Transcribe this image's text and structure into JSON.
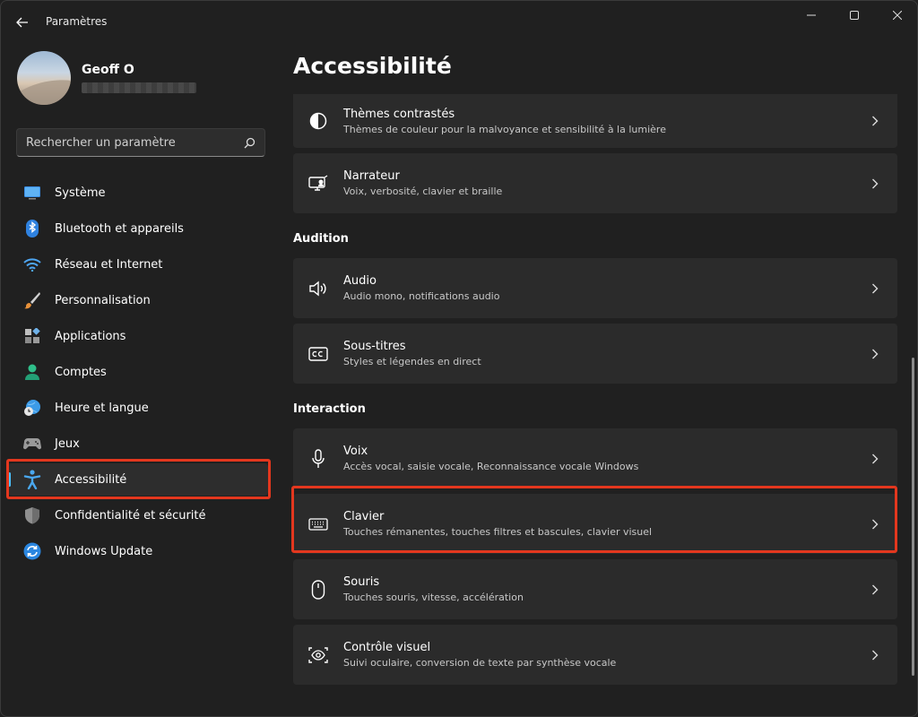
{
  "window": {
    "title": "Paramètres"
  },
  "profile": {
    "name": "Geoff O"
  },
  "search": {
    "placeholder": "Rechercher un paramètre"
  },
  "nav": {
    "items": [
      {
        "label": "Système",
        "icon": "monitor-icon"
      },
      {
        "label": "Bluetooth et appareils",
        "icon": "bluetooth-icon"
      },
      {
        "label": "Réseau et Internet",
        "icon": "wifi-icon"
      },
      {
        "label": "Personnalisation",
        "icon": "brush-icon"
      },
      {
        "label": "Applications",
        "icon": "apps-icon"
      },
      {
        "label": "Comptes",
        "icon": "person-icon"
      },
      {
        "label": "Heure et langue",
        "icon": "globe-clock-icon"
      },
      {
        "label": "Jeux",
        "icon": "gamepad-icon"
      },
      {
        "label": "Accessibilité",
        "icon": "accessibility-icon",
        "active": true
      },
      {
        "label": "Confidentialité et sécurité",
        "icon": "shield-icon"
      },
      {
        "label": "Windows Update",
        "icon": "update-icon"
      }
    ]
  },
  "main": {
    "title": "Accessibilité",
    "vision_cards": [
      {
        "title": "Thèmes contrastés",
        "subtitle": "Thèmes de couleur pour la malvoyance et sensibilité à la lumière",
        "icon": "contrast-icon"
      },
      {
        "title": "Narrateur",
        "subtitle": "Voix, verbosité, clavier et braille",
        "icon": "narrator-icon"
      }
    ],
    "audition_title": "Audition",
    "audition_cards": [
      {
        "title": "Audio",
        "subtitle": "Audio mono, notifications audio",
        "icon": "speaker-icon"
      },
      {
        "title": "Sous-titres",
        "subtitle": "Styles et légendes en direct",
        "icon": "captions-icon"
      }
    ],
    "interaction_title": "Interaction",
    "interaction_cards": [
      {
        "title": "Voix",
        "subtitle": "Accès vocal, saisie vocale, Reconnaissance vocale Windows",
        "icon": "microphone-icon"
      },
      {
        "title": "Clavier",
        "subtitle": "Touches rémanentes, touches filtres et bascules, clavier visuel",
        "icon": "keyboard-icon"
      },
      {
        "title": "Souris",
        "subtitle": "Touches souris, vitesse, accélération",
        "icon": "mouse-icon"
      },
      {
        "title": "Contrôle visuel",
        "subtitle": "Suivi oculaire, conversion de texte par synthèse vocale",
        "icon": "eye-control-icon"
      }
    ]
  },
  "colors": {
    "background": "#202020",
    "card": "#2b2b2b",
    "accent": "#4cc2ff",
    "highlight": "#e3371e"
  }
}
